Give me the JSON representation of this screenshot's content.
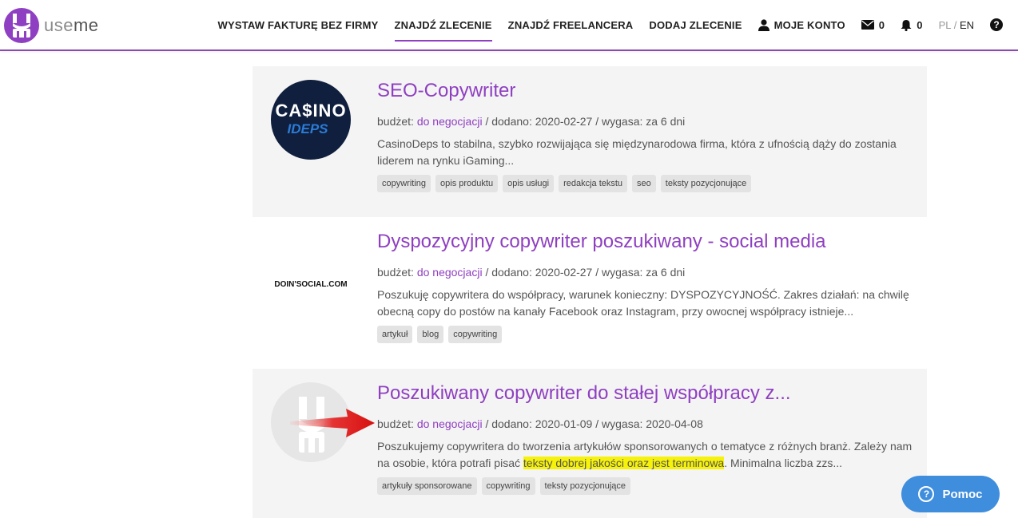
{
  "header": {
    "logo_text_light": "use",
    "logo_text_bold": "me",
    "nav": [
      {
        "label": "WYSTAW FAKTURĘ BEZ FIRMY"
      },
      {
        "label": "ZNAJDŹ ZLECENIE"
      },
      {
        "label": "ZNAJDŹ FREELANCERA"
      },
      {
        "label": "DODAJ ZLECENIE"
      },
      {
        "label": "MOJE KONTO"
      }
    ],
    "messages_count": "0",
    "notifications_count": "0",
    "lang_pl": "PL",
    "lang_sep": "/",
    "lang_en": "EN",
    "help": "?"
  },
  "listings": [
    {
      "title": "SEO-Copywriter",
      "budget_label": "budżet:",
      "budget_value": "do negocjacji",
      "meta_rest": "/ dodano: 2020-02-27 / wygasa: za 6 dni",
      "description": "CasinoDeps to stabilna, szybko rozwijająca się międzynarodowa firma, która z ufnością dąży do zostania liderem na rynku iGaming...",
      "logo_text_top": "CA$INO",
      "logo_text_bottom": "IDEPS",
      "tags": [
        "copywriting",
        "opis produktu",
        "opis usługi",
        "redakcja tekstu",
        "seo",
        "teksty pozycjonujące"
      ]
    },
    {
      "title": "Dyspozycyjny copywriter poszukiwany - social media",
      "budget_label": "budżet:",
      "budget_value": "do negocjacji",
      "meta_rest": "/ dodano: 2020-02-27 / wygasa: za 6 dni",
      "description": "Poszukuję copywritera do współpracy, warunek konieczny: DYSPOZYCYJNOŚĆ. Zakres działań: na chwilę obecną copy do postów na kanały Facebook oraz Instagram, przy owocnej współpracy istnieje...",
      "logo_text": "DOIN'SOCIAL.COM",
      "tags": [
        "artykuł",
        "blog",
        "copywriting"
      ]
    },
    {
      "title": "Poszukiwany copywriter do stałej współpracy z...",
      "budget_label": "budżet:",
      "budget_value": "do negocjacji",
      "meta_rest": "/ dodano: 2020-01-09 / wygasa: 2020-04-08",
      "description_before": "Poszukujemy copywritera do tworzenia artykułów sponsorowanych o tematyce z różnych branż. Zależy nam na osobie, która potrafi pisać ",
      "description_highlight": "teksty dobrej jakości oraz jest terminowa",
      "description_after": ". Minimalna liczba zzs...",
      "tags": [
        "artykuły sponsorowane",
        "copywriting",
        "teksty pozycjonujące"
      ]
    }
  ],
  "help_button": {
    "label": "Pomoc",
    "icon": "?"
  },
  "colors": {
    "brand": "#8f3fc1",
    "help": "#3f8ede",
    "highlight": "#f7f20a"
  }
}
